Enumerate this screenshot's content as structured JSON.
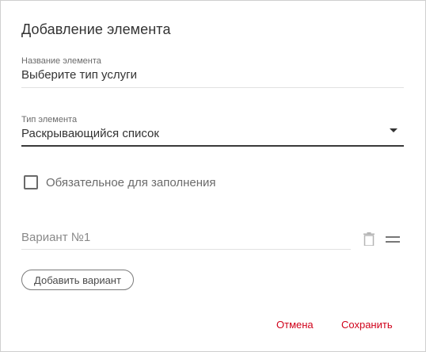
{
  "dialog": {
    "title": "Добавление элемента"
  },
  "name_field": {
    "label": "Название элемента",
    "value": "Выберите тип услуги"
  },
  "type_field": {
    "label": "Тип элемента",
    "value": "Раскрывающийся список"
  },
  "required_checkbox": {
    "label": "Обязательное для заполнения",
    "checked": false
  },
  "variants": [
    {
      "placeholder": "Вариант №1",
      "value": ""
    }
  ],
  "add_variant_label": "Добавить вариант",
  "actions": {
    "cancel_label": "Отмена",
    "save_label": "Сохранить"
  },
  "colors": {
    "accent": "#d0021b",
    "text": "#333333",
    "muted": "#6b6b6b"
  }
}
